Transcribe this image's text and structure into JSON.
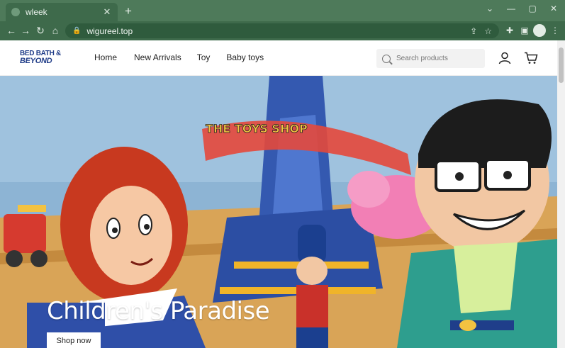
{
  "browser": {
    "tab_title": "wleek",
    "tab_close": "✕",
    "new_tab": "+",
    "url": "wigureel.top",
    "window_controls": [
      "⌄",
      "—",
      "▢",
      "✕"
    ]
  },
  "site": {
    "logo_line1": "BED BATH &",
    "logo_line2": "BEYOND",
    "nav": [
      "Home",
      "New Arrivals",
      "Toy",
      "Baby toys"
    ],
    "search_placeholder": "Search products"
  },
  "hero": {
    "title": "Children's Paradise",
    "cta": "Shop now",
    "sign_text": "THE TOYS SHOP"
  },
  "colors": {
    "chrome": "#4e7a5a",
    "toolbar": "#3e6a4b",
    "logo": "#1f3c88"
  }
}
